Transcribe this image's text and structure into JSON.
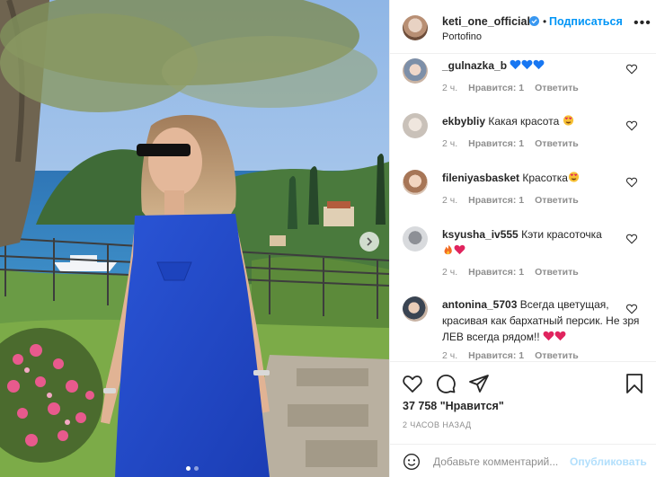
{
  "post": {
    "author": "keti_one_official",
    "separator": "•",
    "follow_label": "Подписаться",
    "location": "Portofino",
    "more_label": "•••",
    "colors": {
      "accent": "#0095f6",
      "muted": "#8e8e8e",
      "text": "#262626",
      "heart": "#ed4956",
      "blue_heart": "#1877f2"
    }
  },
  "photo": {
    "icon": "chevron-right-icon",
    "carousel_count": 2,
    "carousel_active": 0
  },
  "comments": [
    {
      "user": "_gulnazka_b",
      "text": "",
      "emoji": [
        "blue-heart",
        "blue-heart",
        "blue-heart"
      ],
      "time": "2 ч.",
      "likes": "Нравится: 1",
      "reply": "Ответить"
    },
    {
      "user": "ekbybliy",
      "text": "Какая красота",
      "emoji": [
        "heart-eyes"
      ],
      "time": "2 ч.",
      "likes": "Нравится: 1",
      "reply": "Ответить"
    },
    {
      "user": "fileniyasbasket",
      "text": "Красотка",
      "emoji": [
        "heart-eyes"
      ],
      "time": "2 ч.",
      "likes": "Нравится: 1",
      "reply": "Ответить"
    },
    {
      "user": "ksyusha_iv555",
      "text": "Кэти красоточка",
      "emoji": [
        "fire",
        "red-heart"
      ],
      "time": "2 ч.",
      "likes": "Нравится: 1",
      "reply": "Ответить"
    },
    {
      "user": "antonina_5703",
      "text": "Всегда цветущая, красивая как бархатный персик. Не зря ЛЕВ всегда рядом!!",
      "emoji": [
        "red-heart",
        "red-heart"
      ],
      "time": "2 ч.",
      "likes": "Нравится: 1",
      "reply": "Ответить"
    }
  ],
  "actions": {
    "likes_count": "37 758",
    "likes_suffix": "\"Нравится\"",
    "time_ago": "2 ЧАСОВ НАЗАД"
  },
  "add_comment": {
    "placeholder": "Добавьте комментарий...",
    "publish_label": "Опубликовать"
  }
}
